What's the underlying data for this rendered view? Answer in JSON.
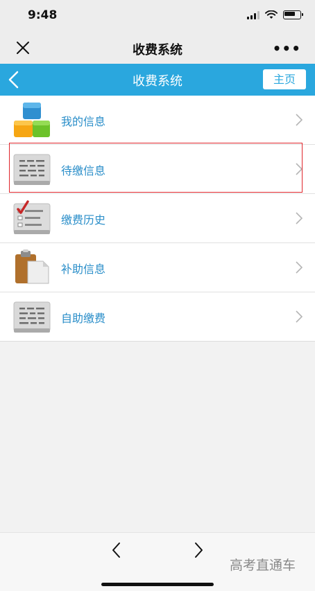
{
  "status_bar": {
    "time": "9:48"
  },
  "wechat_bar": {
    "title": "收费系统",
    "more": "•••"
  },
  "app_nav": {
    "title": "收费系统",
    "home_label": "主页"
  },
  "menu": {
    "items": [
      {
        "label": "我的信息",
        "icon": "blocks-icon"
      },
      {
        "label": "待缴信息",
        "icon": "document-lines-icon"
      },
      {
        "label": "缴费历史",
        "icon": "checklist-icon"
      },
      {
        "label": "补助信息",
        "icon": "clipboard-icon"
      },
      {
        "label": "自助缴费",
        "icon": "document-lines-icon"
      }
    ]
  },
  "watermark": "高考直通车",
  "colors": {
    "nav_bg": "#2aa7de",
    "label": "#2a8ec9",
    "highlight": "#e0252b"
  }
}
